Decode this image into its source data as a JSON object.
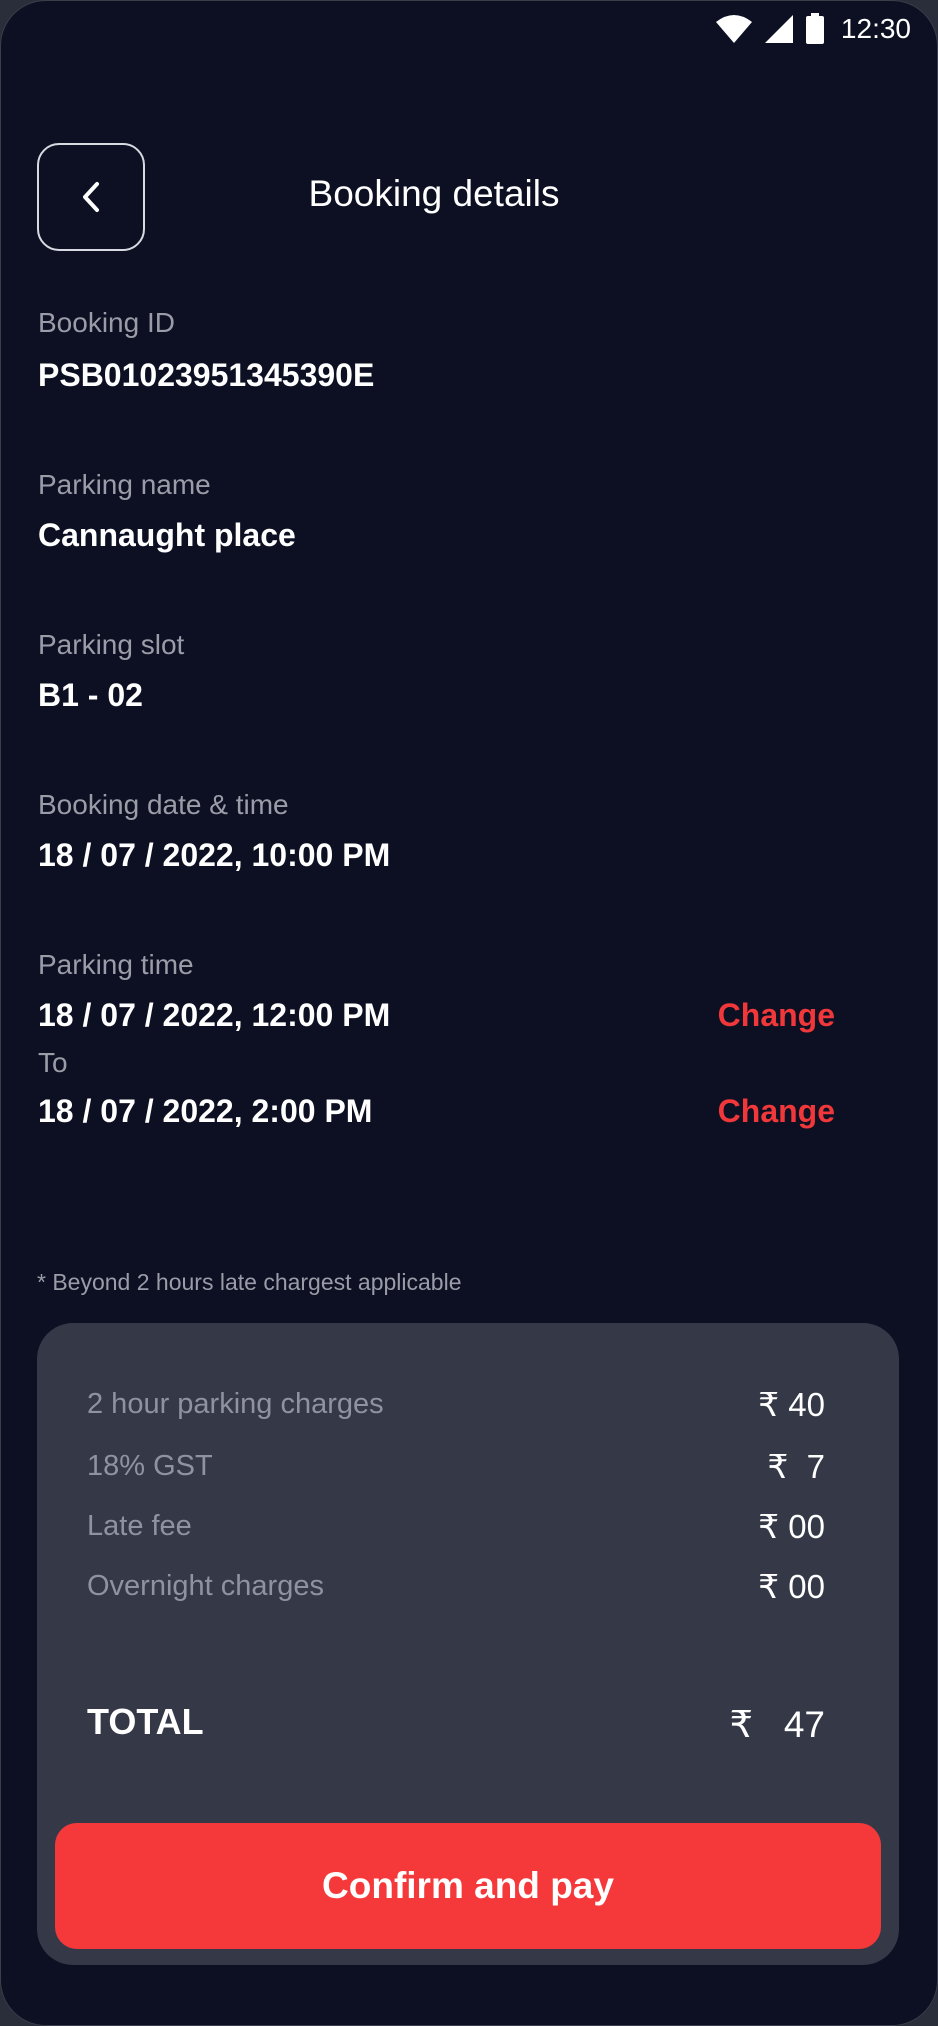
{
  "status_bar": {
    "time": "12:30",
    "icons": [
      "wifi-icon",
      "signal-icon",
      "battery-icon"
    ]
  },
  "header": {
    "title": "Booking details",
    "back_icon": "chevron-left-icon"
  },
  "fields": {
    "booking_id": {
      "label": "Booking ID",
      "value": "PSB01023951345390E"
    },
    "parking_name": {
      "label": "Parking name",
      "value": "Cannaught place"
    },
    "parking_slot": {
      "label": "Parking slot",
      "value": "B1 - 02"
    },
    "booking_datetime": {
      "label": "Booking date & time",
      "value": "18 / 07 / 2022, 10:00 PM"
    },
    "parking_time": {
      "label": "Parking time",
      "from": "18 / 07 / 2022, 12:00 PM",
      "to_label": "To",
      "to": "18 / 07 / 2022, 2:00 PM",
      "change_label": "Change"
    }
  },
  "note": "* Beyond 2 hours late chargest applicable",
  "summary": {
    "rows": [
      {
        "label": "2 hour parking charges",
        "amount": "₹ 40"
      },
      {
        "label": "18% GST",
        "amount": "₹  7"
      },
      {
        "label": "Late fee",
        "amount": "₹ 00"
      },
      {
        "label": "Overnight charges",
        "amount": "₹ 00"
      }
    ],
    "total_label": "TOTAL",
    "total_amount": "₹   47",
    "confirm_label": "Confirm and pay"
  },
  "colors": {
    "background": "#0c1022",
    "card": "#353847",
    "accent": "#f5393b",
    "muted_text": "#9a9ca8"
  }
}
